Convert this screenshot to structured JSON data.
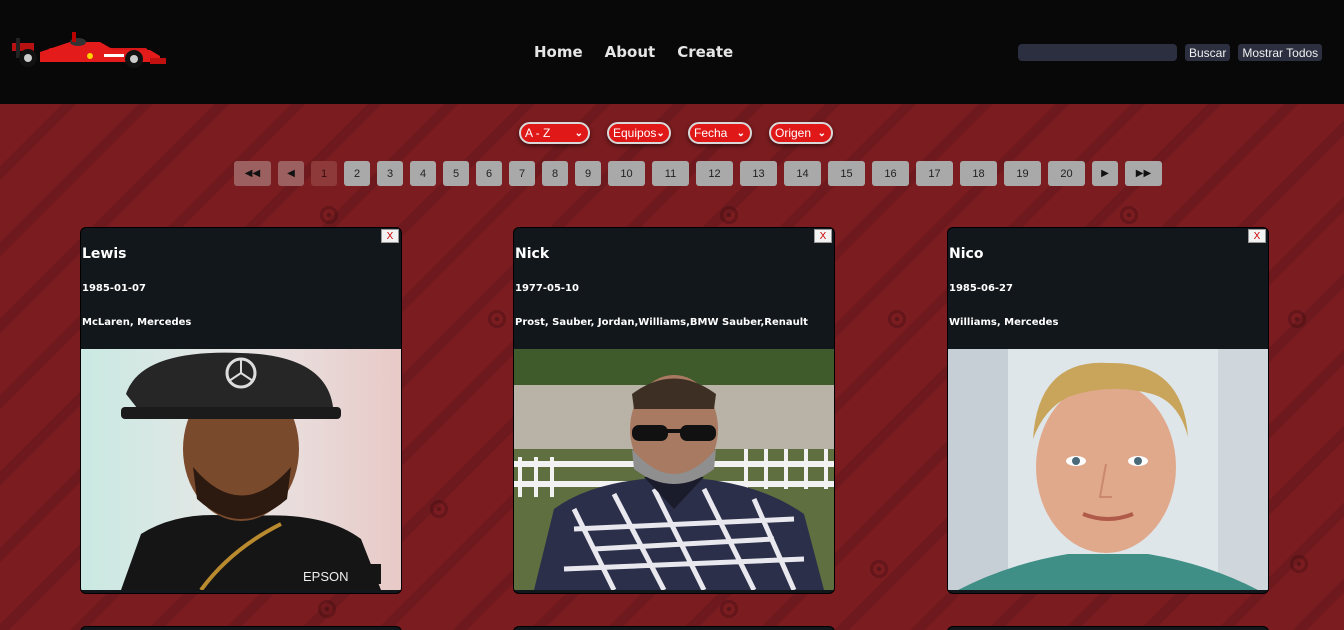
{
  "header": {
    "logo": "ferrari-f1-car-logo",
    "nav": [
      "Home",
      "About",
      "Create"
    ],
    "search": {
      "value": "",
      "placeholder": "",
      "button": "Buscar",
      "show_all": "Mostrar Todos"
    }
  },
  "filters": [
    {
      "label": "A - Z"
    },
    {
      "label": "Equipos"
    },
    {
      "label": "Fecha"
    },
    {
      "label": "Origen"
    }
  ],
  "pagination": {
    "first": "◀◀",
    "prev": "◀",
    "pages": [
      "1",
      "2",
      "3",
      "4",
      "5",
      "6",
      "7",
      "8",
      "9",
      "10",
      "11",
      "12",
      "13",
      "14",
      "15",
      "16",
      "17",
      "18",
      "19",
      "20"
    ],
    "current": "1",
    "next": "▶",
    "last": "▶▶"
  },
  "close_label": "X",
  "drivers": [
    {
      "name": "Lewis",
      "dob": "1985-01-07",
      "teams": "McLaren, Mercedes"
    },
    {
      "name": "Nick",
      "dob": "1977-05-10",
      "teams": "Prost, Sauber, Jordan,Williams,BMW Sauber,Renault"
    },
    {
      "name": "Nico",
      "dob": "1985-06-27",
      "teams": "Williams, Mercedes"
    }
  ],
  "colors": {
    "header_bg": "#080808",
    "page_bg": "#7a1c20",
    "filter_red": "#e01818",
    "card_bg": "#12171b"
  }
}
